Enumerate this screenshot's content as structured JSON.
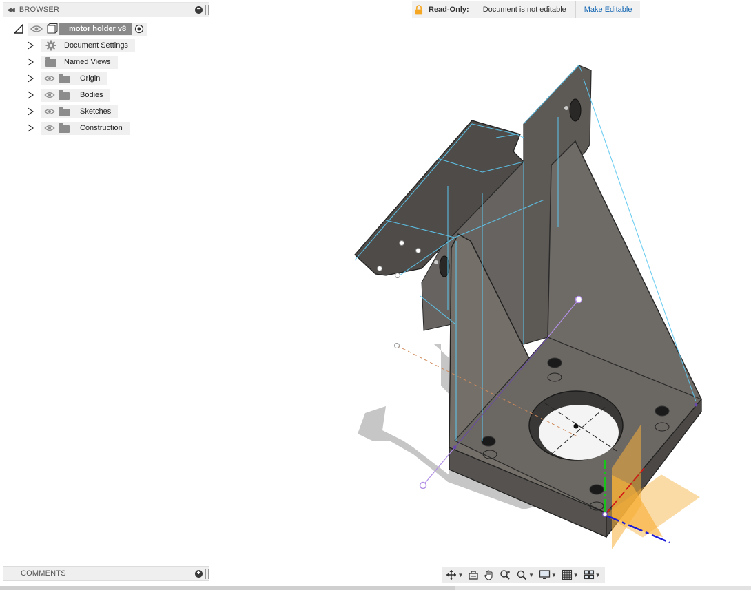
{
  "browser": {
    "title": "BROWSER",
    "root": {
      "label": "motor holder v8"
    },
    "items": [
      {
        "label": "Document Settings",
        "icon": "gear-icon",
        "has_eye": false
      },
      {
        "label": "Named Views",
        "icon": "folder-icon",
        "has_eye": false
      },
      {
        "label": "Origin",
        "icon": "folder-icon",
        "has_eye": true
      },
      {
        "label": "Bodies",
        "icon": "folder-icon",
        "has_eye": true
      },
      {
        "label": "Sketches",
        "icon": "folder-icon",
        "has_eye": true
      },
      {
        "label": "Construction",
        "icon": "folder-icon",
        "has_eye": true
      }
    ]
  },
  "readonly": {
    "label": "Read-Only:",
    "message": "Document is not editable",
    "action": "Make Editable",
    "lock_color": "#f5a623"
  },
  "comments": {
    "title": "COMMENTS"
  },
  "nav_toolbar": {
    "tools": [
      "orbit-icon",
      "look-at-icon",
      "pan-icon",
      "zoom-icon",
      "fit-icon",
      "display-settings-icon",
      "grid-icon",
      "viewports-icon"
    ]
  },
  "colors": {
    "model_face": "#6e6a66",
    "model_face_dark": "#595551",
    "edge_highlight": "#5ec8f0",
    "axis_green": "#18c418",
    "axis_blue": "#1a1ad8",
    "axis_red": "#d41818",
    "origin_plane": "#f7b13a"
  }
}
